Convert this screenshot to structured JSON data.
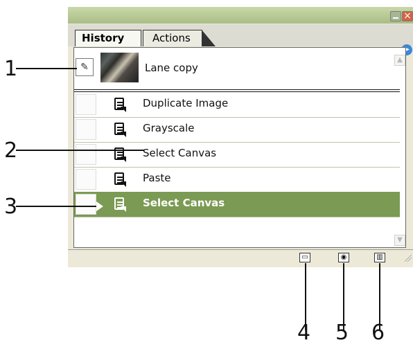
{
  "panel": {
    "tabs": [
      {
        "label": "History"
      },
      {
        "label": "Actions"
      }
    ],
    "snapshot": {
      "label": "Lane copy"
    },
    "states": [
      {
        "label": "Duplicate Image"
      },
      {
        "label": "Grayscale"
      },
      {
        "label": "Select Canvas"
      },
      {
        "label": "Paste"
      },
      {
        "label": "Select Canvas"
      }
    ]
  },
  "callouts": [
    "1",
    "2",
    "3",
    "4",
    "5",
    "6"
  ],
  "icons": {
    "minimize": "minimize-icon",
    "close": "close-icon",
    "panel_menu": "panel-menu-icon",
    "brush": "brush-icon",
    "new_document": "new-document-icon",
    "snapshot": "camera-icon",
    "trash": "trash-icon"
  },
  "colors": {
    "selected_row": "#7b9a53",
    "panel_bg": "#ECE9D8"
  }
}
